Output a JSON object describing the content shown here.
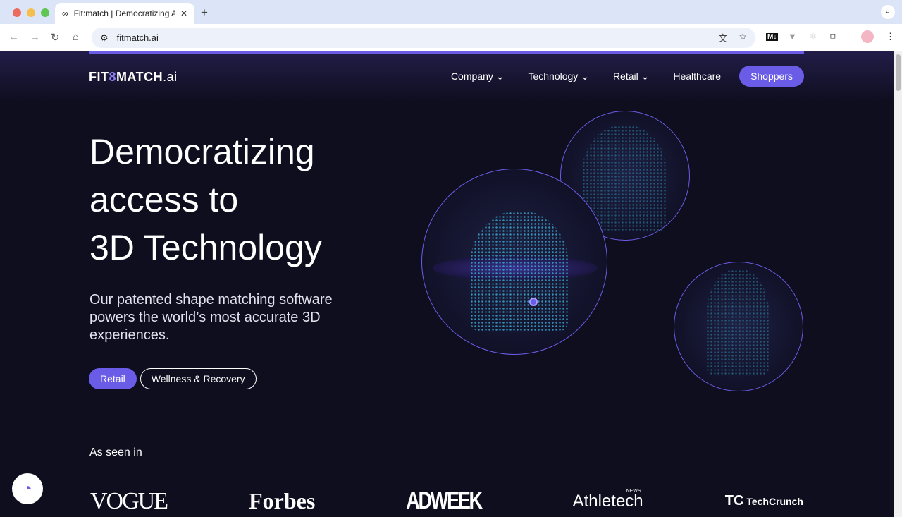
{
  "browser": {
    "tab_title": "Fit:match | Democratizing Acc",
    "url": "fitmatch.ai"
  },
  "nav": {
    "logo": "FIT",
    "logo_mark": "8",
    "logo_rest": "MATCH",
    "logo_suffix": ".ai",
    "items": [
      {
        "label": "Company",
        "dropdown": true
      },
      {
        "label": "Technology",
        "dropdown": true
      },
      {
        "label": "Retail",
        "dropdown": true
      },
      {
        "label": "Healthcare",
        "dropdown": false
      }
    ],
    "cta": "Shoppers"
  },
  "hero": {
    "line1": "Democratizing",
    "line2": "access to",
    "line3": "3D Technology",
    "subtitle": "Our patented shape matching software powers the world’s most accurate 3D experiences.",
    "buttons": [
      "Retail",
      "Wellness & Recovery"
    ]
  },
  "press": {
    "heading": "As seen in",
    "logos": [
      "VOGUE",
      "Forbes",
      "ADWEEK",
      "Athletech",
      "TechCrunch"
    ],
    "athletech_badge": "NEWS"
  },
  "colors": {
    "accent": "#6b5ce7",
    "background": "#0f0e1f"
  }
}
